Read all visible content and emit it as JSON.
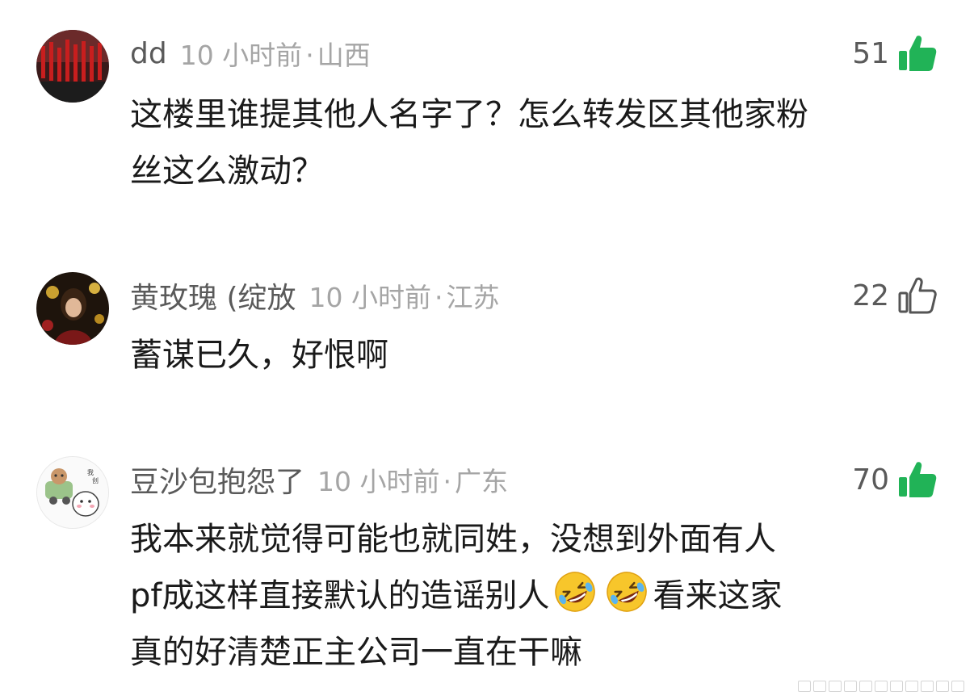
{
  "comments": [
    {
      "username": "dd",
      "time": "10 小时前",
      "separator": "·",
      "location": "山西",
      "likes": "51",
      "liked": true,
      "lines": [
        "这楼里谁提其他人名字了？怎么转发区其他家粉",
        "丝这么激动？"
      ]
    },
    {
      "username": "黄玫瑰 (绽放",
      "time": "10 小时前",
      "separator": "·",
      "location": "江苏",
      "likes": "22",
      "liked": false,
      "lines": [
        "蓄谋已久，好恨啊"
      ]
    },
    {
      "username": "豆沙包抱怨了",
      "time": "10 小时前",
      "separator": "·",
      "location": "广东",
      "likes": "70",
      "liked": true,
      "lines": [
        "我本来就觉得可能也就同姓，没想到外面有人"
      ],
      "line2_prefix": "pf成这样直接默认的造谣别人",
      "line2_suffix": "看来这家",
      "line3": "真的好清楚正主公司一直在干嘛",
      "emoji_name": "rolling-on-floor-laughing-emoji"
    }
  ],
  "colors": {
    "liked_thumb": "#21b357",
    "unliked_thumb": "#555555",
    "username": "#5a5a5a",
    "meta": "#a5a5a5",
    "text": "#1a1a1a"
  }
}
